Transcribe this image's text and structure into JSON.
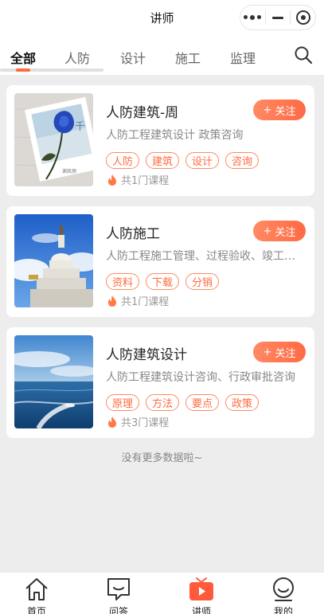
{
  "header": {
    "title": "讲师"
  },
  "tabs": [
    "全部",
    "人防",
    "设计",
    "施工",
    "监理"
  ],
  "cards": [
    {
      "title": "人防建筑-周",
      "desc": "人防工程建筑设计 政策咨询",
      "follow": "关注",
      "tags": [
        "人防",
        "建筑",
        "设计",
        "咨询"
      ],
      "count": "共1门课程"
    },
    {
      "title": "人防施工",
      "desc": "人防工程施工管理、过程验收、竣工验收",
      "follow": "关注",
      "tags": [
        "资料",
        "下载",
        "分销"
      ],
      "count": "共1门课程"
    },
    {
      "title": "人防建筑设计",
      "desc": "人防工程建筑设计咨询、行政审批咨询",
      "follow": "关注",
      "tags": [
        "原理",
        "方法",
        "要点",
        "政策"
      ],
      "count": "共3门课程"
    }
  ],
  "footer_text": "没有更多数据啦~",
  "tabbar": [
    {
      "label": "首页",
      "icon": "home-icon"
    },
    {
      "label": "问答",
      "icon": "chat-icon"
    },
    {
      "label": "讲师",
      "icon": "video-icon",
      "active": true
    },
    {
      "label": "我的",
      "icon": "user-icon"
    }
  ],
  "colors": {
    "accent": "#ff6a3d",
    "background": "#ededed"
  }
}
